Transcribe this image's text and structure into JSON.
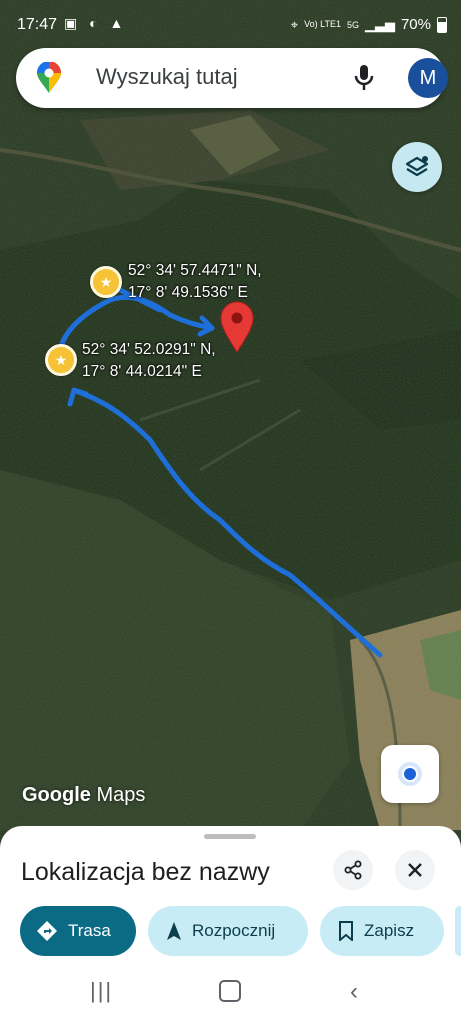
{
  "status_bar": {
    "time": "17:47",
    "network": "Vo) LTE1",
    "signal_label": "5G",
    "battery": "70%"
  },
  "search": {
    "placeholder": "Wyszukaj tutaj",
    "avatar_letter": "M"
  },
  "map": {
    "waypoints": [
      {
        "lat": "52° 34' 57.4471\" N,",
        "lng": "17° 8' 49.1536\" E"
      },
      {
        "lat": "52° 34' 52.0291\" N,",
        "lng": "17° 8' 44.0214\" E"
      }
    ],
    "logo": {
      "google": "Google",
      "maps": "Maps"
    },
    "route_color": "#1e6fd9",
    "pin_color": "#e53935",
    "waypoint_color": "#f6c236"
  },
  "place_sheet": {
    "title": "Lokalizacja bez nazwy",
    "actions": [
      "Trasa",
      "Rozpocznij",
      "Zapisz"
    ],
    "accent": "#0b6b85"
  },
  "icons": {
    "share": "share-icon",
    "close": "close-icon",
    "layers": "layers-icon",
    "my_location": "my-location-icon"
  }
}
